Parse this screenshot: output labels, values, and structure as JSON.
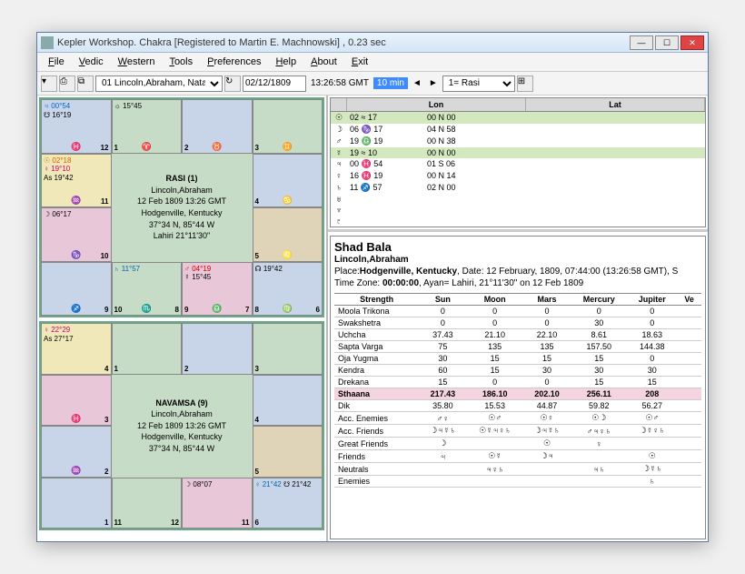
{
  "title": "Kepler Workshop. Chakra  [Registered to Martin E. Machnowski] , 0.23 sec",
  "menu": [
    "File",
    "Vedic",
    "Western",
    "Tools",
    "Preferences",
    "Help",
    "About",
    "Exit"
  ],
  "toolbar": {
    "chart_select": "01 Lincoln,Abraham, Natal",
    "date": "02/12/1809",
    "time": "13:26:58 GMT",
    "step": "10 min",
    "rasi": "1= Rasi"
  },
  "chart1": {
    "title": "RASI (1)",
    "name": "Lincoln,Abraham",
    "date": "12 Feb 1809 13:26 GMT",
    "place": "Hodgenville, Kentucky",
    "coords": "37°34 N,  85°44 W",
    "ayan": "Lahiri  21°11'30\"",
    "cells": {
      "c1": [
        "♃ 00°54",
        "☋ 16°19"
      ],
      "c2": [
        "☼ 15°45"
      ],
      "c3": [],
      "c4": [],
      "c5": [
        "☉ 02°18",
        "♀ 19°10",
        "As 19°42"
      ],
      "c8": [],
      "c9": [
        "☽ 06°17"
      ],
      "c12": [],
      "c13": [],
      "c14": [
        "♄ 11°57"
      ],
      "c15": [
        "☿ 04°19",
        "♂ 15°45"
      ],
      "c16": [
        "☊ 19°42"
      ]
    }
  },
  "chart2": {
    "title": "NAVAMSA (9)",
    "name": "Lincoln,Abraham",
    "date": "12 Feb 1809 13:26 GMT",
    "place": "Hodgenville, Kentucky",
    "coords": "37°34 N,  85°44 W",
    "c1": [
      "♀ 22°29",
      "As 27°17"
    ],
    "c15": [
      "☽ 08°07"
    ],
    "c16a": "♀ 21°42",
    "c16b": "☋ 21°42"
  },
  "planets": {
    "headers": [
      "",
      "Lon",
      "Lat"
    ],
    "rows": [
      {
        "sym": "☉",
        "lon": "02 ≈ 17",
        "lat": "00 N 00",
        "hl": true
      },
      {
        "sym": "☽",
        "lon": "06 ♑ 17",
        "lat": "04 N 58"
      },
      {
        "sym": "♂",
        "lon": "19 ♎ 19",
        "lat": "00 N 38"
      },
      {
        "sym": "☿",
        "lon": "19 ≈ 10",
        "lat": "00 N 00",
        "hl": true
      },
      {
        "sym": "♃",
        "lon": "00 ♓ 54",
        "lat": "01 S 06"
      },
      {
        "sym": "♀",
        "lon": "16 ♓ 19",
        "lat": "00 N 14"
      },
      {
        "sym": "♄",
        "lon": "11 ♐ 57",
        "lat": "02 N 00"
      },
      {
        "sym": "♅",
        "lon": "",
        "lat": ""
      },
      {
        "sym": "♆",
        "lon": "",
        "lat": ""
      },
      {
        "sym": "♇",
        "lon": "",
        "lat": ""
      }
    ]
  },
  "shad": {
    "title": "Shad Bala",
    "name": "Lincoln,Abraham",
    "place_label": "Place:",
    "place": "Hodgenville, Kentucky",
    "date_label": ", Date: 12 February, 1809, 07:44:00 (13:26:58 GMT), S",
    "tz_label": "Time Zone: ",
    "tz": "00:00:00",
    "ayan": ", Ayan= Lahiri,  21°11'30\" on 12 Feb 1809",
    "headers": [
      "Strength",
      "Sun",
      "Moon",
      "Mars",
      "Mercury",
      "Jupiter",
      "Ve"
    ],
    "rows": [
      [
        "Moola Trikona",
        "0",
        "0",
        "0",
        "0",
        "0",
        ""
      ],
      [
        "Swakshetra",
        "0",
        "0",
        "0",
        "30",
        "0",
        ""
      ],
      [
        "Uchcha",
        "37.43",
        "21.10",
        "22.10",
        "8.61",
        "18.63",
        ""
      ],
      [
        "Sapta Varga",
        "75",
        "135",
        "135",
        "157.50",
        "144.38",
        ""
      ],
      [
        "Oja Yugma",
        "30",
        "15",
        "15",
        "15",
        "0",
        ""
      ],
      [
        "Kendra",
        "60",
        "15",
        "30",
        "30",
        "30",
        ""
      ],
      [
        "Drekana",
        "15",
        "0",
        "0",
        "15",
        "15",
        ""
      ]
    ],
    "sthana": [
      "Sthaana",
      "217.43",
      "186.10",
      "202.10",
      "256.11",
      "208",
      ""
    ],
    "dik": [
      "Dik",
      "35.80",
      "15.53",
      "44.87",
      "59.82",
      "56.27",
      ""
    ],
    "friends": [
      [
        "Acc. Enemies",
        "♂♀",
        "☉♂",
        "☉♀",
        "☉☽",
        "☉♂",
        ""
      ],
      [
        "Acc. Friends",
        "☽♃☿♄",
        "☉☿♃♀♄",
        "☽♃☿♄",
        "♂♃♀♄",
        "☽☿♀♄",
        ""
      ],
      [
        "Great Friends",
        "☽",
        "",
        "☉",
        "♀",
        "",
        ""
      ],
      [
        "Friends",
        "♃",
        "☉☿",
        "☽♃",
        "",
        "☉",
        ""
      ],
      [
        "Neutrals",
        "",
        "♃♀♄",
        "",
        "♃♄",
        "☽☿♄",
        ""
      ],
      [
        "Enemies",
        "",
        "",
        "",
        "",
        "♄",
        ""
      ]
    ]
  }
}
